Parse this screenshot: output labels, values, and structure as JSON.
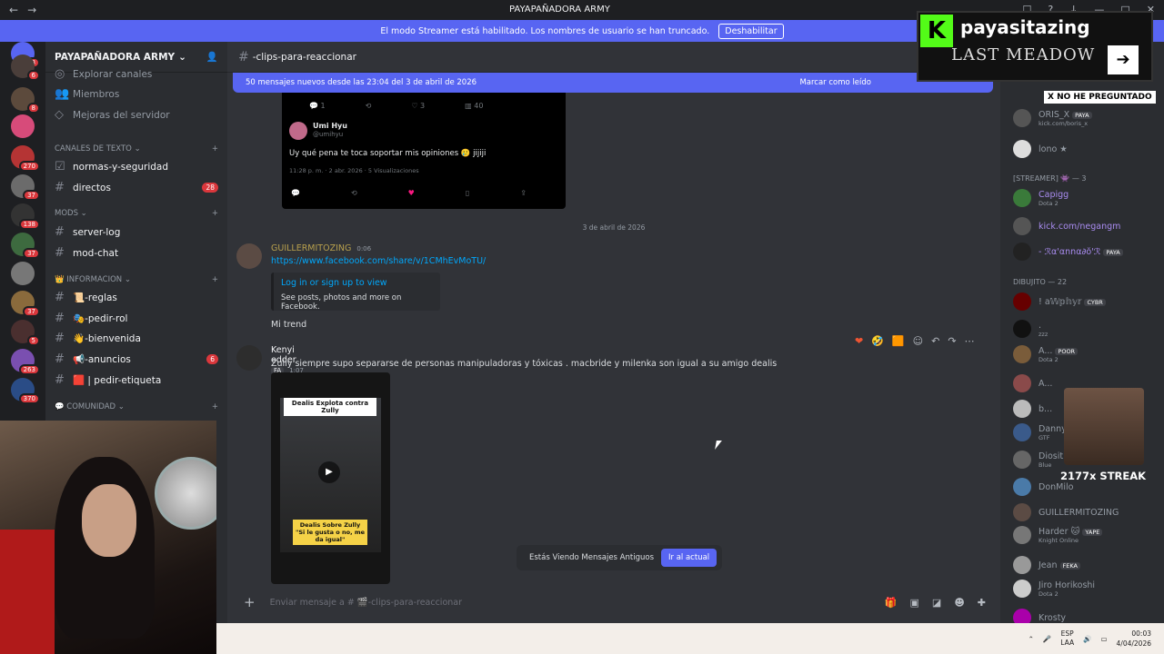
{
  "window": {
    "title": "PAYAPAÑADORA ARMY"
  },
  "streamer_bar": {
    "text": "El modo Streamer está habilitado. Los nombres de usuario se han truncado.",
    "button": "Deshabilitar"
  },
  "guild_badges": [
    "228",
    "6",
    "8",
    "270",
    "37",
    "138",
    "37",
    "37",
    "5",
    "263",
    "370"
  ],
  "server": {
    "name": "PAYAPAÑADORA ARMY"
  },
  "channels": {
    "top": [
      "Explorar canales",
      "Miembros",
      "Mejoras del servidor"
    ],
    "cat_text": "Canales de texto",
    "text": [
      {
        "name": "normas-y-seguridad",
        "badge": ""
      },
      {
        "name": "directos",
        "badge": "28"
      }
    ],
    "cat_mods": "MODS",
    "mods": [
      "server-log",
      "mod-chat"
    ],
    "cat_info": "INFORMACION",
    "info": [
      {
        "name": "📜-reglas",
        "badge": ""
      },
      {
        "name": "🎭-pedir-rol",
        "badge": ""
      },
      {
        "name": "👋-bienvenida",
        "badge": ""
      },
      {
        "name": "📢-anuncios",
        "badge": "6"
      },
      {
        "name": "🟥 | pedir-etiqueta",
        "badge": ""
      }
    ],
    "cat_comm": "COMUNIDAD"
  },
  "main": {
    "channel": "-clips-para-reaccionar",
    "new_bar": "50 mensajes nuevos desde las 23:04 del 3 de abril de 2026",
    "new_bar_action": "Marcar como leído",
    "tweet": {
      "counts": [
        "1",
        "",
        "3",
        "40"
      ],
      "author": "Umi Hyu",
      "handle": "@umihyu",
      "text": "Uy qué pena te toca soportar mis opiniones 🥲 jijiji",
      "meta": "11:28 p. m. · 2 abr. 2026 · 5 Visualizaciones"
    },
    "date_sep": "3 de abril de 2026",
    "msg1": {
      "user": "GUILLERMITOZING",
      "time": "0:06",
      "link": "https://www.facebook.com/share/v/1CMhEvMoTU/",
      "embed_title": "Log in or sign up to view",
      "embed_desc": "See posts, photos and more on Facebook.",
      "text": "Mi trend"
    },
    "msg2": {
      "user": "Kenyi edder",
      "tag": "FA",
      "time": "1:07",
      "text": "Zully siempre supo separarse de personas manipuladoras y tóxicas . macbride y milenka son igual a su amigo dealis",
      "video_top": "Dealis Explota contra Zully",
      "video_bottom": "Dealis Sobre Zully \"Si le gusta o no, me da igual\""
    },
    "old_msgs": "Estás Viendo Mensajes Antiguos",
    "old_go": "Ir al actual",
    "input_placeholder": "Enviar mensaje a # 🎬-clips-para-reaccionar"
  },
  "members": {
    "top": [
      {
        "name": "ORIS_X",
        "tag": "PAYA",
        "sub": "kick.com/boris_x"
      },
      {
        "name": "lono ★",
        "tag": "",
        "sub": ""
      }
    ],
    "group_streamer": "[STREAMER] 👾 — 3",
    "streamers": [
      {
        "name": "Capigg",
        "sub": "Dota 2",
        "tag": ""
      },
      {
        "name": "kick.com/negangm",
        "sub": "",
        "tag": ""
      },
      {
        "name": "- ℛα'αnnα∂ŏ'ℛ",
        "sub": "",
        "tag": "PAYA"
      }
    ],
    "group_dibujito": "DIBUJITO — 22",
    "dibujito": [
      {
        "name": "! a𝕎𝕡𝕙𝕪𝕣",
        "sub": "",
        "tag": "CYBR"
      },
      {
        "name": ".",
        "sub": "zzz",
        "tag": ""
      },
      {
        "name": "A...",
        "sub": "Dota 2",
        "tag": "POOR"
      },
      {
        "name": "A...",
        "sub": "",
        "tag": ""
      },
      {
        "name": "b...",
        "sub": "",
        "tag": ""
      },
      {
        "name": "Danny",
        "sub": "GTF",
        "tag": ""
      },
      {
        "name": "Diosit",
        "sub": "Blue",
        "tag": ""
      },
      {
        "name": "DonMilo",
        "sub": "",
        "tag": ""
      },
      {
        "name": "GUILLERMITOZING",
        "sub": "",
        "tag": ""
      },
      {
        "name": "Harder 🐱",
        "sub": "Knight Online",
        "tag": "YAPE"
      },
      {
        "name": "Jean",
        "sub": "",
        "tag": "FEKA"
      },
      {
        "name": "Jiro Horikoshi",
        "sub": "Dota 2",
        "tag": ""
      },
      {
        "name": "Krosty",
        "sub": "",
        "tag": ""
      }
    ]
  },
  "overlay": {
    "brand": "payasitazing",
    "game": "LAST MEADOW",
    "nohe": "X NO HE PREGUNTADO",
    "streak": "2177x STREAK"
  },
  "taskbar": {
    "lang1": "ESP",
    "lang2": "LAA",
    "time": "00:03",
    "date": "4/04/2026"
  }
}
